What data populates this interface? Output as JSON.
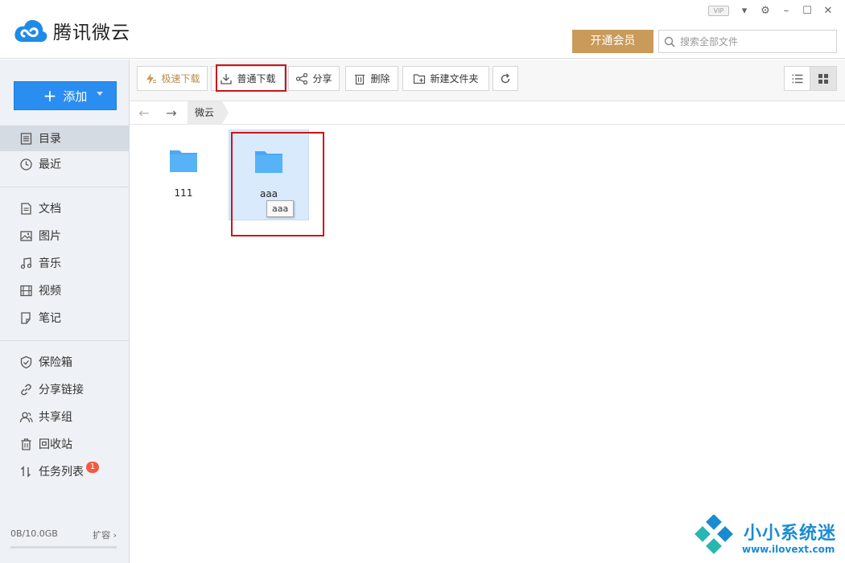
{
  "app": {
    "title": "腾讯微云"
  },
  "window_controls": {
    "vip": "VIP"
  },
  "header": {
    "vip_button": "开通会员",
    "search_placeholder": "搜索全部文件"
  },
  "sidebar": {
    "add_button": "添加",
    "items": [
      {
        "label": "目录",
        "icon": "directory-icon"
      },
      {
        "label": "最近",
        "icon": "clock-icon"
      },
      {
        "label": "文档",
        "icon": "document-icon"
      },
      {
        "label": "图片",
        "icon": "picture-icon"
      },
      {
        "label": "音乐",
        "icon": "music-icon"
      },
      {
        "label": "视频",
        "icon": "video-icon"
      },
      {
        "label": "笔记",
        "icon": "note-icon"
      },
      {
        "label": "保险箱",
        "icon": "shield-icon"
      },
      {
        "label": "分享链接",
        "icon": "link-icon"
      },
      {
        "label": "共享组",
        "icon": "group-icon"
      },
      {
        "label": "回收站",
        "icon": "trash-icon"
      },
      {
        "label": "任务列表",
        "icon": "transfer-icon",
        "badge": "1"
      }
    ],
    "storage": {
      "used": "0B/10.0GB",
      "expand": "扩容",
      "fraction": 0.0
    }
  },
  "toolbar": {
    "fast_download": "极速下载",
    "normal_download": "普通下载",
    "share": "分享",
    "delete": "删除",
    "new_folder": "新建文件夹"
  },
  "breadcrumb": {
    "current": "微云"
  },
  "files": [
    {
      "name": "111",
      "selected": false
    },
    {
      "name": "aaa",
      "selected": true
    }
  ],
  "tooltip": "aaa",
  "watermark": {
    "title": "小小系统迷",
    "url": "www.ilovext.com"
  },
  "colors": {
    "accent": "#2a8df0",
    "vip": "#c99a5a",
    "folder": "#4aa8f5",
    "highlight": "#d0121b",
    "badge": "#f05b41"
  }
}
